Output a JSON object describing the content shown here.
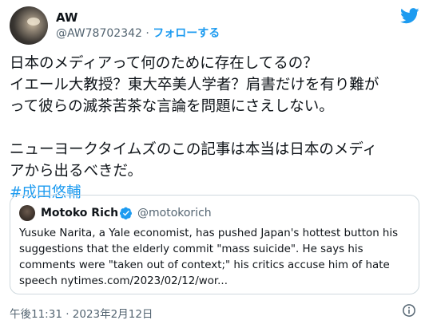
{
  "author": {
    "name": "AW",
    "handle": "@AW78702342",
    "separator": "·",
    "follow_label": "フォローする"
  },
  "tweet": {
    "lines": [
      "日本のメディアって何のために存在してるの？",
      "イエール大教授？東大卒美人学者？肩書だけを有り難が",
      "って彼らの滅茶苦茶な言論を問題にさえしない。",
      "ニューヨークタイムズのこの記事は本当は日本のメディ",
      "アから出るべきだ。"
    ],
    "hashtag": "#成田悠輔"
  },
  "quote": {
    "name": "Motoko Rich",
    "handle": "@motokorich",
    "lines": [
      "Yusuke Narita, a Yale economist, has pushed Japan's hottest button his",
      "suggestions that the elderly commit \"mass suicide\". He says his",
      "comments were \"taken out of context;\" his critics accuse him of hate",
      "speech nytimes.com/2023/02/12/wor..."
    ]
  },
  "footer": {
    "timestamp": "午後11:31 · 2023年2月12日"
  },
  "colors": {
    "accent": "#1d9bf0",
    "text": "#0f1419",
    "muted": "#536471",
    "border": "#cfd9de"
  },
  "icons": [
    "twitter-bird-icon",
    "verified-badge-icon",
    "info-icon"
  ]
}
